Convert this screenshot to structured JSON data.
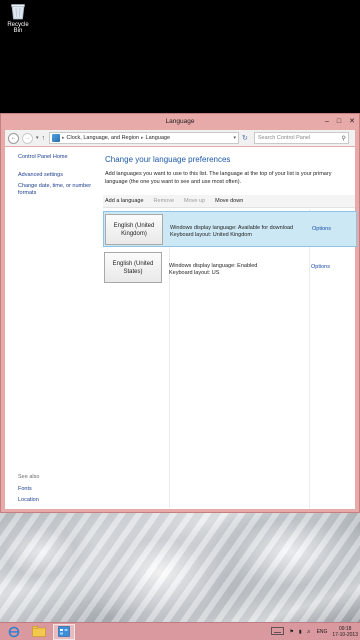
{
  "desktop": {
    "recycle_bin_label": "Recycle Bin"
  },
  "window": {
    "title": "Language",
    "address": {
      "crumbs": [
        "Clock, Language, and Region",
        "Language"
      ],
      "search_placeholder": "Search Control Panel"
    },
    "left_pane": {
      "home_link": "Control Panel Home",
      "advanced_link": "Advanced settings",
      "change_formats_link": "Change date, time, or number formats",
      "see_also_label": "See also",
      "fonts_link": "Fonts",
      "location_link": "Location"
    },
    "main": {
      "heading": "Change your language preferences",
      "description": "Add languages you want to use to this list. The language at the top of your list is your primary language (the one you want to see and use most often).",
      "toolbar": {
        "add": "Add a language",
        "remove": "Remove",
        "move_up": "Move up",
        "move_down": "Move down"
      },
      "languages": [
        {
          "name": "English (United Kingdom)",
          "display_line": "Windows display language: Available for download",
          "keyboard_line": "Keyboard layout: United Kingdom",
          "options_label": "Options",
          "selected": true
        },
        {
          "name": "English (United States)",
          "display_line": "Windows display language: Enabled",
          "keyboard_line": "Keyboard layout: US",
          "options_label": "Options",
          "selected": false
        }
      ]
    }
  },
  "taskbar": {
    "language_indicator": "ENG",
    "time": "09:18",
    "date": "17-10-2013"
  },
  "colors": {
    "window_frame": "#e8a9a9",
    "taskbar": "#d9999e",
    "heading_blue": "#1e5aa8",
    "selected_row": "#cce8f4",
    "link_blue": "#1c3f8f"
  },
  "icons": [
    "recycle-bin-icon",
    "back-icon",
    "forward-icon",
    "up-icon",
    "control-panel-icon",
    "refresh-icon",
    "search-icon",
    "minimize-icon",
    "maximize-icon",
    "close-icon",
    "ie-icon",
    "explorer-icon",
    "control-panel-taskbar-icon",
    "keyboard-icon",
    "flag-icon",
    "network-icon",
    "volume-icon"
  ]
}
